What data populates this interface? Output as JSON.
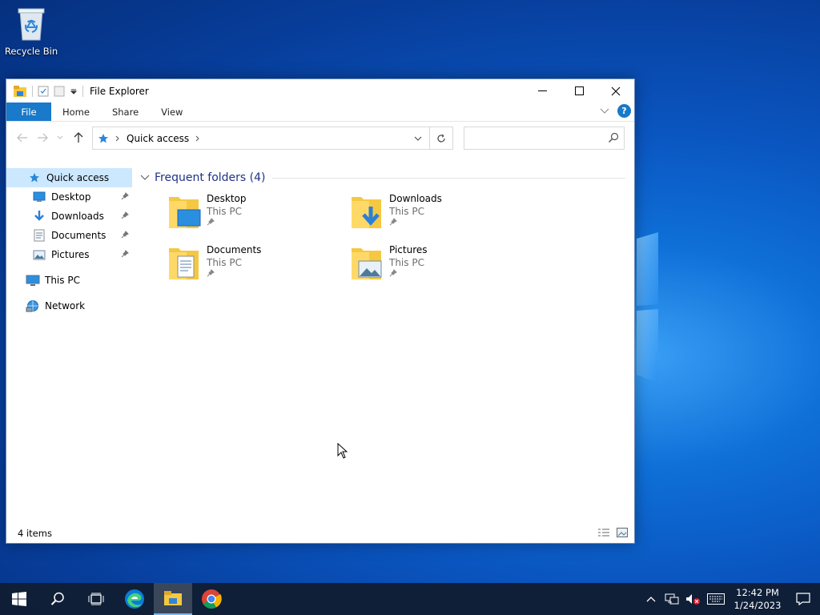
{
  "desktop": {
    "recycle_bin_label": "Recycle Bin"
  },
  "window": {
    "title": "File Explorer",
    "ribbon_tabs": [
      "File",
      "Home",
      "Share",
      "View"
    ],
    "breadcrumb": "Quick access",
    "search_placeholder": ""
  },
  "sidebar": {
    "quick_access": "Quick access",
    "pinned": [
      {
        "label": "Desktop",
        "icon": "desktop-folder-icon"
      },
      {
        "label": "Downloads",
        "icon": "downloads-folder-icon"
      },
      {
        "label": "Documents",
        "icon": "documents-folder-icon"
      },
      {
        "label": "Pictures",
        "icon": "pictures-folder-icon"
      }
    ],
    "this_pc": "This PC",
    "network": "Network"
  },
  "content": {
    "group_title": "Frequent folders (4)",
    "folders": [
      {
        "name": "Desktop",
        "location": "This PC"
      },
      {
        "name": "Downloads",
        "location": "This PC"
      },
      {
        "name": "Documents",
        "location": "This PC"
      },
      {
        "name": "Pictures",
        "location": "This PC"
      }
    ]
  },
  "status": {
    "item_count": "4 items"
  },
  "taskbar": {
    "apps": [
      "start-icon",
      "search-icon",
      "task-view-icon",
      "edge-icon",
      "file-explorer-icon",
      "chrome-icon"
    ],
    "time": "12:42 PM",
    "date": "1/24/2023"
  },
  "colors": {
    "accent": "#1979ca",
    "selection": "#cce8ff",
    "group_title": "#1e3287",
    "folder_yellow": "#f5c842"
  }
}
